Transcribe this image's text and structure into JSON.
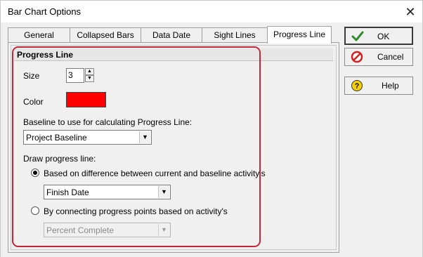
{
  "window": {
    "title": "Bar Chart Options"
  },
  "tabs": [
    {
      "label": "General"
    },
    {
      "label": "Collapsed Bars"
    },
    {
      "label": "Data Date"
    },
    {
      "label": "Sight Lines"
    },
    {
      "label": "Progress Line",
      "active": true
    }
  ],
  "progress_line": {
    "section_title": "Progress Line",
    "size_label": "Size",
    "size_value": "3",
    "color_label": "Color",
    "color_value": "#ff0000",
    "baseline_label": "Baseline to use for calculating Progress Line:",
    "baseline_value": "Project Baseline",
    "draw_label": "Draw progress line:",
    "option1_label": "Based on difference between current and baseline activity's",
    "option1_checked": true,
    "option1_value": "Finish Date",
    "option2_label": "By connecting progress points based on activity's",
    "option2_checked": false,
    "option2_value": "Percent Complete"
  },
  "buttons": {
    "ok": "OK",
    "cancel": "Cancel",
    "help": "Help"
  },
  "colors": {
    "highlight": "#c0283a",
    "swatch": "#ff0000",
    "ok_icon": "#2e8b2e",
    "cancel_icon": "#d42020",
    "help_icon": "#e8c100"
  },
  "icons": {
    "close": "close-icon",
    "ok": "checkmark-icon",
    "cancel": "no-entry-icon",
    "help": "question-icon"
  }
}
